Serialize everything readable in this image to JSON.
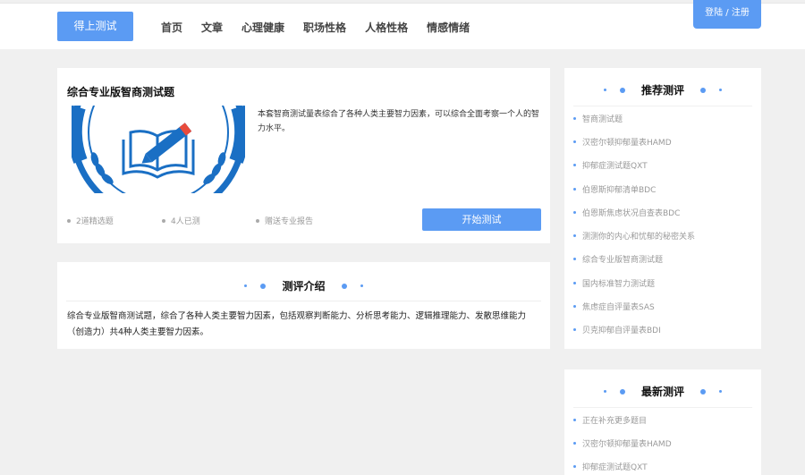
{
  "header": {
    "logo_label": "得上测试",
    "nav": [
      "首页",
      "文章",
      "心理健康",
      "职场性格",
      "人格性格",
      "情感情绪"
    ],
    "login_label": "登陆 / 注册"
  },
  "quiz": {
    "title": "综合专业版智商测试题",
    "description": "本套智商测试量表综合了各种人类主要智力因素，可以综合全面考察一个人的智力水平。",
    "meta": [
      "2道精选题",
      "4人已测",
      "赠送专业报告"
    ],
    "start_label": "开始测试",
    "colors": {
      "accent": "#5b9bf3",
      "image_blue": "#1a6fc4"
    }
  },
  "intro": {
    "heading": "测评介绍",
    "text": "综合专业版智商测试题，综合了各种人类主要智力因素，包括观察判断能力、分析思考能力、逻辑推理能力、发散思维能力（创造力）共4种人类主要智力因素。"
  },
  "recommended": {
    "heading": "推荐测评",
    "items": [
      "智商测试题",
      "汉密尔顿抑郁量表HAMD",
      "抑郁症测试题QXT",
      "伯恩斯抑郁清单BDC",
      "伯恩斯焦虑状况自查表BDC",
      "测测你的内心和忧郁的秘密关系",
      "综合专业版智商测试题",
      "国内标准智力测试题",
      "焦虑症自评量表SAS",
      "贝克抑郁自评量表BDI"
    ]
  },
  "latest": {
    "heading": "最新测评",
    "items": [
      "正在补充更多题目",
      "汉密尔顿抑郁量表HAMD",
      "抑郁症测试题QXT"
    ]
  }
}
